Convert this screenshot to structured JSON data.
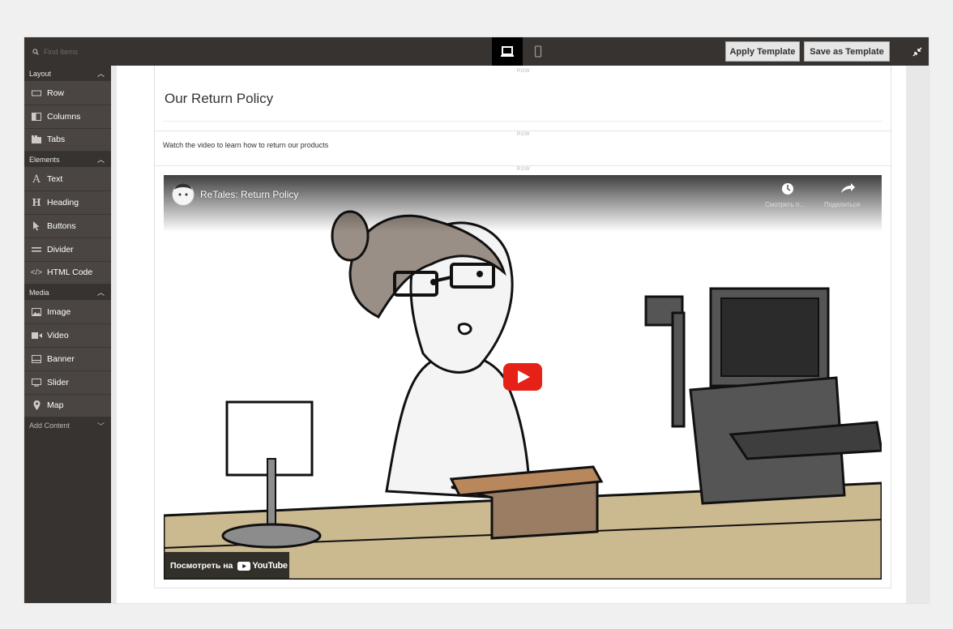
{
  "search": {
    "placeholder": "Find Items"
  },
  "toolbar": {
    "apply_label": "Apply Template",
    "save_label": "Save as Template"
  },
  "sidebar": {
    "groups": [
      {
        "label": "Layout",
        "items": [
          {
            "label": "Row",
            "icon": "row-icon"
          },
          {
            "label": "Columns",
            "icon": "columns-icon"
          },
          {
            "label": "Tabs",
            "icon": "tabs-icon"
          }
        ]
      },
      {
        "label": "Elements",
        "items": [
          {
            "label": "Text",
            "icon": "text-icon"
          },
          {
            "label": "Heading",
            "icon": "heading-icon"
          },
          {
            "label": "Buttons",
            "icon": "cursor-icon"
          },
          {
            "label": "Divider",
            "icon": "divider-icon"
          },
          {
            "label": "HTML Code",
            "icon": "code-icon"
          }
        ]
      },
      {
        "label": "Media",
        "items": [
          {
            "label": "Image",
            "icon": "image-icon"
          },
          {
            "label": "Video",
            "icon": "video-icon"
          },
          {
            "label": "Banner",
            "icon": "banner-icon"
          },
          {
            "label": "Slider",
            "icon": "slider-icon"
          },
          {
            "label": "Map",
            "icon": "map-pin-icon"
          }
        ]
      }
    ],
    "add_content": "Add Content"
  },
  "stage": {
    "row_label": "ROW",
    "heading": "Our Return Policy",
    "text": "Watch the video to learn how to return our products"
  },
  "video": {
    "title": "ReTales: Return Policy",
    "watch_later": "Смотреть п...",
    "share": "Поделиться",
    "watch_on": "Посмотреть на",
    "youtube": "YouTube"
  }
}
